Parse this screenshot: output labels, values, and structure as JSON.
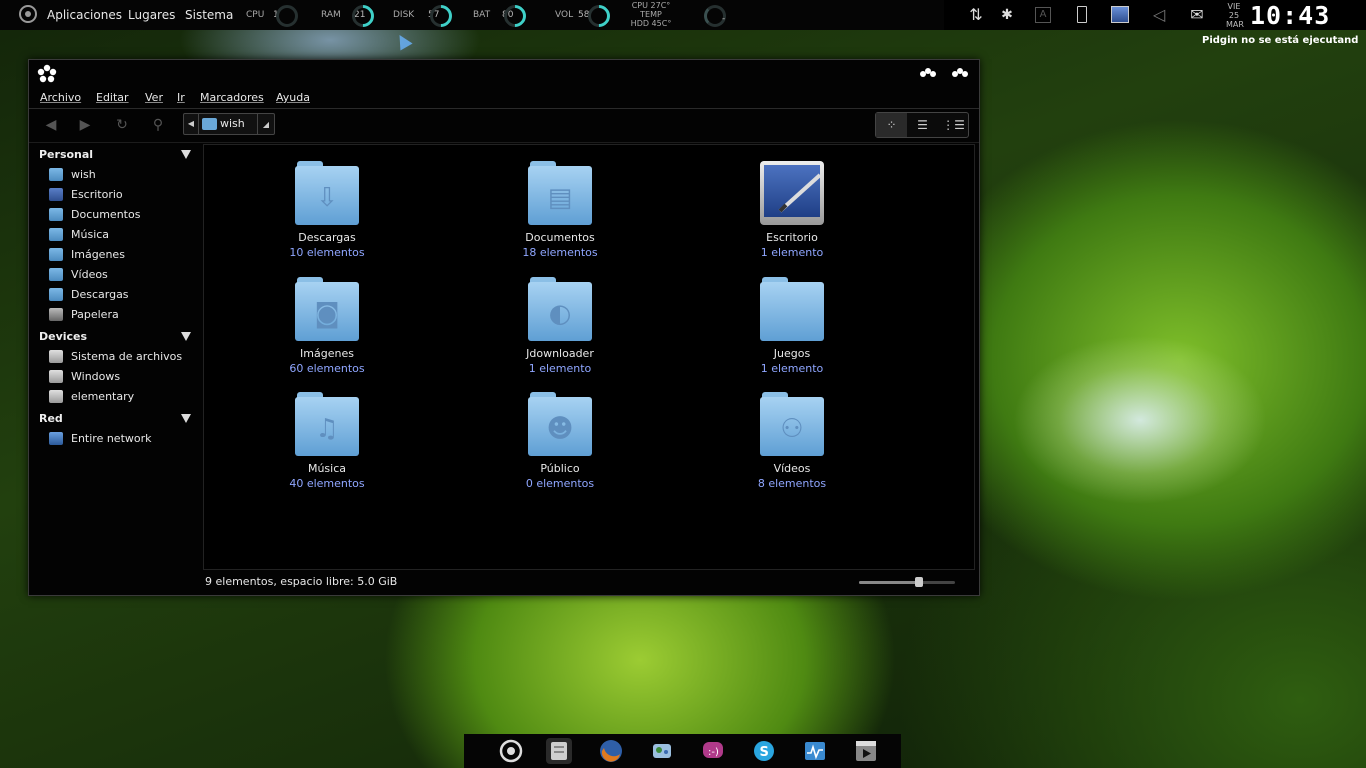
{
  "top_panel": {
    "menus": [
      "Aplicaciones",
      "Lugares",
      "Sistema"
    ],
    "monitors": [
      {
        "label": "CPU",
        "value": "1"
      },
      {
        "label": "RAM",
        "value": "21"
      },
      {
        "label": "DISK",
        "value": "57"
      },
      {
        "label": "BAT",
        "value": "80"
      },
      {
        "label": "VOL",
        "value": "58"
      }
    ],
    "temps": {
      "cpu": "CPU 27C°",
      "title": "TEMP",
      "hdd": "HDD 45C°"
    },
    "extra_value": "-",
    "date": {
      "day": "VIE",
      "num": "25",
      "month": "MAR"
    },
    "clock": "10:43",
    "notice": "Pidgin no se está ejecutand",
    "tray_icons": [
      "network-arrows-icon",
      "bluetooth-icon",
      "keyboard-icon",
      "battery-icon",
      "screen-icon",
      "volume-icon",
      "mail-icon"
    ]
  },
  "window": {
    "menubar": [
      "Archivo",
      "Editar",
      "Ver",
      "Ir",
      "Marcadores",
      "Ayuda"
    ],
    "path": {
      "current": "wish"
    },
    "sidebar": {
      "sections": [
        {
          "title": "Personal",
          "items": [
            {
              "label": "wish",
              "icon": "home-folder-icon"
            },
            {
              "label": "Escritorio",
              "icon": "desktop-icon"
            },
            {
              "label": "Documentos",
              "icon": "documents-folder-icon"
            },
            {
              "label": "Música",
              "icon": "music-folder-icon"
            },
            {
              "label": "Imágenes",
              "icon": "pictures-folder-icon"
            },
            {
              "label": "Vídeos",
              "icon": "videos-folder-icon"
            },
            {
              "label": "Descargas",
              "icon": "downloads-folder-icon"
            },
            {
              "label": "Papelera",
              "icon": "trash-icon"
            }
          ]
        },
        {
          "title": "Devices",
          "items": [
            {
              "label": "Sistema de archivos",
              "icon": "drive-icon"
            },
            {
              "label": "Windows",
              "icon": "drive-icon"
            },
            {
              "label": "elementary",
              "icon": "drive-icon"
            }
          ]
        },
        {
          "title": "Red",
          "items": [
            {
              "label": "Entire network",
              "icon": "network-icon"
            }
          ]
        }
      ]
    },
    "files": [
      {
        "name": "Descargas",
        "count": "10 elementos",
        "glyph": "⇩"
      },
      {
        "name": "Documentos",
        "count": "18 elementos",
        "glyph": "▤"
      },
      {
        "name": "Escritorio",
        "count": "1 elemento",
        "glyph": ""
      },
      {
        "name": "Imágenes",
        "count": "60 elementos",
        "glyph": "◙"
      },
      {
        "name": "Jdownloader",
        "count": "1 elemento",
        "glyph": "◐"
      },
      {
        "name": "Juegos",
        "count": "1 elemento",
        "glyph": ""
      },
      {
        "name": "Música",
        "count": "40 elementos",
        "glyph": "♫"
      },
      {
        "name": "Público",
        "count": "0 elementos",
        "glyph": "☻"
      },
      {
        "name": "Vídeos",
        "count": "8 elementos",
        "glyph": "⚇"
      }
    ],
    "status": "9 elementos, espacio libre: 5.0 GiB",
    "zoom_level": 0.63
  },
  "dock": {
    "items": [
      {
        "name": "dock-item-ubuntu-one",
        "color": "#dddddd"
      },
      {
        "name": "dock-item-file-manager",
        "color": "#cfcfcf"
      },
      {
        "name": "dock-item-firefox",
        "color": "#e07a20"
      },
      {
        "name": "dock-item-network-manager",
        "color": "#6aa2d8"
      },
      {
        "name": "dock-item-empathy",
        "color": "#b03a8a"
      },
      {
        "name": "dock-item-skype",
        "color": "#2aa6e0"
      },
      {
        "name": "dock-item-system-monitor",
        "color": "#3a8ad0"
      },
      {
        "name": "dock-item-video-player",
        "color": "#888888"
      }
    ]
  }
}
